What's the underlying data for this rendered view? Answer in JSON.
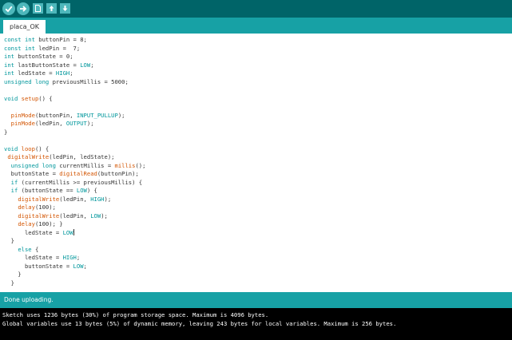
{
  "colors": {
    "toolbar": "#006468",
    "tab_strip": "#17a1a5",
    "button": "#4db7bb",
    "keyword": "#00979c",
    "function": "#d35400",
    "console_bg": "#000000"
  },
  "toolbar": {
    "icons": [
      "verify-icon",
      "upload-icon",
      "new-sketch-icon",
      "open-icon",
      "save-icon"
    ]
  },
  "tabs": [
    {
      "label": "placa_OK"
    }
  ],
  "code": {
    "lines": [
      [
        {
          "t": "const int",
          "c": "kw"
        },
        {
          "t": " buttonPin = 8;"
        }
      ],
      [
        {
          "t": "const int",
          "c": "kw"
        },
        {
          "t": " ledPin =  7;"
        }
      ],
      [
        {
          "t": "int",
          "c": "kw"
        },
        {
          "t": " buttonState = 0;"
        }
      ],
      [
        {
          "t": "int",
          "c": "kw"
        },
        {
          "t": " lastButtonState = "
        },
        {
          "t": "LOW",
          "c": "kw"
        },
        {
          "t": ";"
        }
      ],
      [
        {
          "t": "int",
          "c": "kw"
        },
        {
          "t": " ledState = "
        },
        {
          "t": "HIGH",
          "c": "kw"
        },
        {
          "t": ";"
        }
      ],
      [
        {
          "t": "unsigned long",
          "c": "kw"
        },
        {
          "t": " previousMillis = 5000;"
        }
      ],
      [],
      [
        {
          "t": "void",
          "c": "kw"
        },
        {
          "t": " "
        },
        {
          "t": "setup",
          "c": "fn"
        },
        {
          "t": "() {"
        }
      ],
      [],
      [
        {
          "t": "  "
        },
        {
          "t": "pinMode",
          "c": "fn"
        },
        {
          "t": "(buttonPin, "
        },
        {
          "t": "INPUT_PULLUP",
          "c": "kw"
        },
        {
          "t": ");"
        }
      ],
      [
        {
          "t": "  "
        },
        {
          "t": "pinMode",
          "c": "fn"
        },
        {
          "t": "(ledPin, "
        },
        {
          "t": "OUTPUT",
          "c": "kw"
        },
        {
          "t": ");"
        }
      ],
      [
        {
          "t": "}"
        }
      ],
      [],
      [
        {
          "t": "void",
          "c": "kw"
        },
        {
          "t": " "
        },
        {
          "t": "loop",
          "c": "fn"
        },
        {
          "t": "() {"
        }
      ],
      [
        {
          "t": " "
        },
        {
          "t": "digitalWrite",
          "c": "fn"
        },
        {
          "t": "(ledPin, ledState);"
        }
      ],
      [
        {
          "t": "  "
        },
        {
          "t": "unsigned long",
          "c": "kw"
        },
        {
          "t": " currentMillis = "
        },
        {
          "t": "millis",
          "c": "fn"
        },
        {
          "t": "();"
        }
      ],
      [
        {
          "t": "  buttonState = "
        },
        {
          "t": "digitalRead",
          "c": "fn"
        },
        {
          "t": "(buttonPin);"
        }
      ],
      [
        {
          "t": "  "
        },
        {
          "t": "if",
          "c": "kw"
        },
        {
          "t": " (currentMillis >= previousMillis) {"
        }
      ],
      [
        {
          "t": "  "
        },
        {
          "t": "if",
          "c": "kw"
        },
        {
          "t": " (buttonState == "
        },
        {
          "t": "LOW",
          "c": "kw"
        },
        {
          "t": ") {"
        }
      ],
      [
        {
          "t": "    "
        },
        {
          "t": "digitalWrite",
          "c": "fn"
        },
        {
          "t": "(ledPin, "
        },
        {
          "t": "HIGH",
          "c": "kw"
        },
        {
          "t": ");"
        }
      ],
      [
        {
          "t": "    "
        },
        {
          "t": "delay",
          "c": "fn"
        },
        {
          "t": "(100);"
        }
      ],
      [
        {
          "t": "    "
        },
        {
          "t": "digitalWrite",
          "c": "fn"
        },
        {
          "t": "(ledPin, "
        },
        {
          "t": "LOW",
          "c": "kw"
        },
        {
          "t": ");"
        }
      ],
      [
        {
          "t": "    "
        },
        {
          "t": "delay",
          "c": "fn"
        },
        {
          "t": "(100); }"
        }
      ],
      [
        {
          "t": "      ledState = "
        },
        {
          "t": "LOW",
          "c": "kw",
          "caret": true
        }
      ],
      [
        {
          "t": "  }"
        }
      ],
      [
        {
          "t": "    "
        },
        {
          "t": "else",
          "c": "kw"
        },
        {
          "t": " {"
        }
      ],
      [
        {
          "t": "      ledState = "
        },
        {
          "t": "HIGH",
          "c": "kw"
        },
        {
          "t": ";"
        }
      ],
      [
        {
          "t": "      buttonState = "
        },
        {
          "t": "LOW",
          "c": "kw"
        },
        {
          "t": ";"
        }
      ],
      [
        {
          "t": "    }"
        }
      ],
      [
        {
          "t": "  }"
        }
      ]
    ]
  },
  "status": {
    "text": "Done uploading."
  },
  "console": {
    "lines": [
      "Sketch uses 1236 bytes (30%) of program storage space. Maximum is 4096 bytes.",
      "Global variables use 13 bytes (5%) of dynamic memory, leaving 243 bytes for local variables. Maximum is 256 bytes."
    ]
  }
}
